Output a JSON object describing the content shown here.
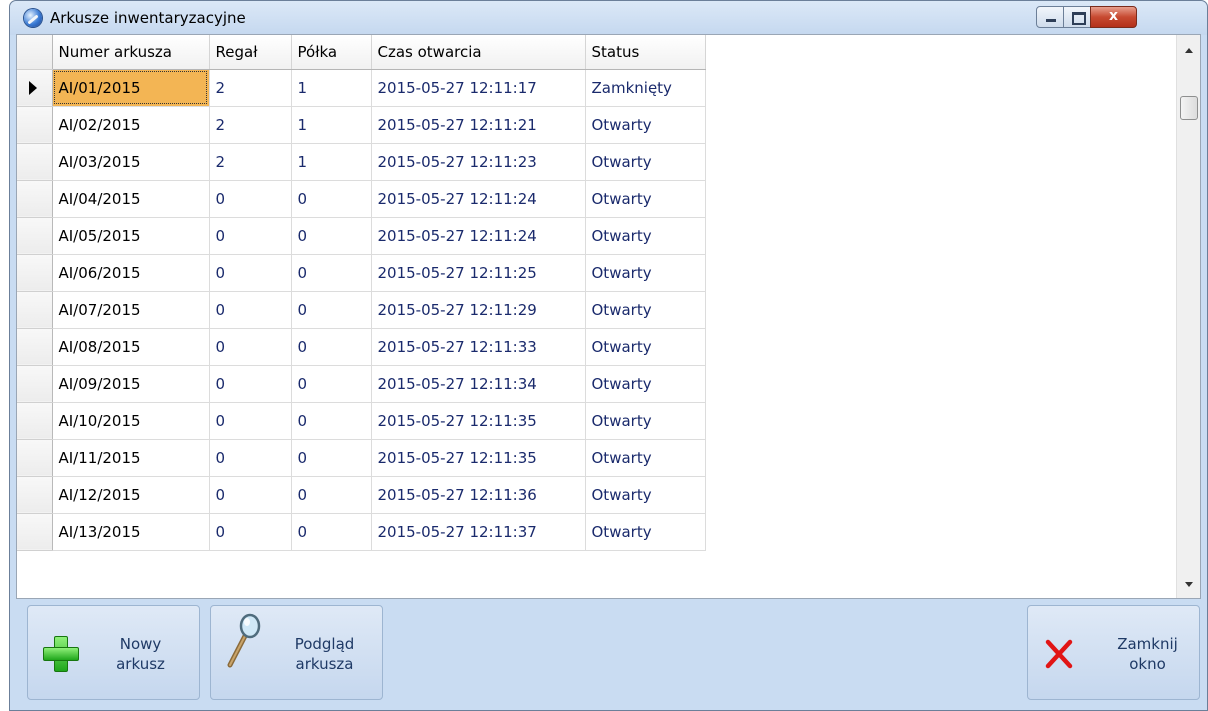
{
  "window": {
    "title": "Arkusze inwentaryzacyjne",
    "close_glyph": "x"
  },
  "grid": {
    "columns": [
      "Numer arkusza",
      "Regał",
      "Półka",
      "Czas otwarcia",
      "Status"
    ],
    "rows": [
      [
        "AI/01/2015",
        "2",
        "1",
        "2015-05-27 12:11:17",
        "Zamknięty"
      ],
      [
        "AI/02/2015",
        "2",
        "1",
        "2015-05-27 12:11:21",
        "Otwarty"
      ],
      [
        "AI/03/2015",
        "2",
        "1",
        "2015-05-27 12:11:23",
        "Otwarty"
      ],
      [
        "AI/04/2015",
        "0",
        "0",
        "2015-05-27 12:11:24",
        "Otwarty"
      ],
      [
        "AI/05/2015",
        "0",
        "0",
        "2015-05-27 12:11:24",
        "Otwarty"
      ],
      [
        "AI/06/2015",
        "0",
        "0",
        "2015-05-27 12:11:25",
        "Otwarty"
      ],
      [
        "AI/07/2015",
        "0",
        "0",
        "2015-05-27 12:11:29",
        "Otwarty"
      ],
      [
        "AI/08/2015",
        "0",
        "0",
        "2015-05-27 12:11:33",
        "Otwarty"
      ],
      [
        "AI/09/2015",
        "0",
        "0",
        "2015-05-27 12:11:34",
        "Otwarty"
      ],
      [
        "AI/10/2015",
        "0",
        "0",
        "2015-05-27 12:11:35",
        "Otwarty"
      ],
      [
        "AI/11/2015",
        "0",
        "0",
        "2015-05-27 12:11:35",
        "Otwarty"
      ],
      [
        "AI/12/2015",
        "0",
        "0",
        "2015-05-27 12:11:36",
        "Otwarty"
      ],
      [
        "AI/13/2015",
        "0",
        "0",
        "2015-05-27 12:11:37",
        "Otwarty"
      ]
    ],
    "selected_row": 0
  },
  "buttons": {
    "new": {
      "line1": "Nowy",
      "line2": "arkusz",
      "icon": "plus-icon"
    },
    "preview": {
      "line1": "Podgląd",
      "line2": "arkusza",
      "icon": "magnifier-icon"
    },
    "close": {
      "line1": "Zamknij",
      "line2": "okno",
      "icon": "close-x-icon"
    }
  },
  "colors": {
    "selection": "#f3b554",
    "cell_text": "#1a2a6c",
    "frame": "#c9dcf2"
  }
}
